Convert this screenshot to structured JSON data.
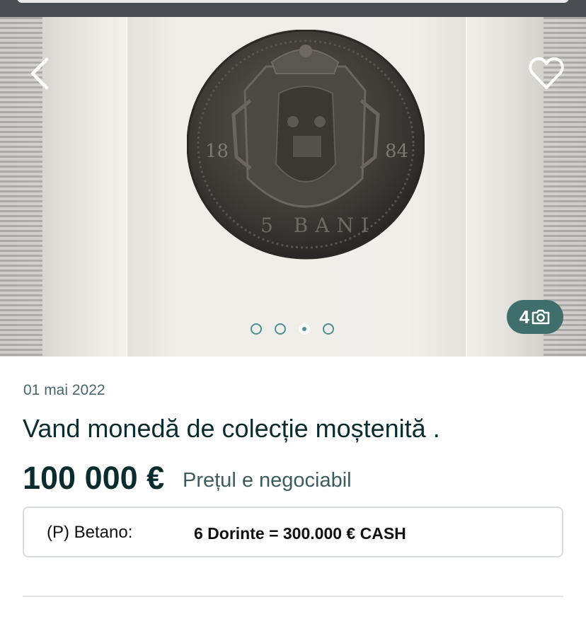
{
  "gallery": {
    "back_icon": "chevron-left-icon",
    "favorite_icon": "heart-outline-icon",
    "photo_count": "4",
    "photo_icon": "camera-icon",
    "dots_total": 4,
    "dot_active_index": 2,
    "coin_inscription_left": "18",
    "coin_inscription_right": "84",
    "coin_inscription_bottom": "5 BANI"
  },
  "listing": {
    "date": "01 mai 2022",
    "title": "Vand monedă de colecție moștenită .",
    "price": "100 000 €",
    "negotiable": "Prețul e negociabil"
  },
  "promo": {
    "label": "(P) Betano:",
    "value": "6 Dorinte = 300.000 € CASH"
  },
  "colors": {
    "accent": "#3f6e6b",
    "title_text": "#0b2c2e",
    "secondary_text": "#4a6668"
  }
}
